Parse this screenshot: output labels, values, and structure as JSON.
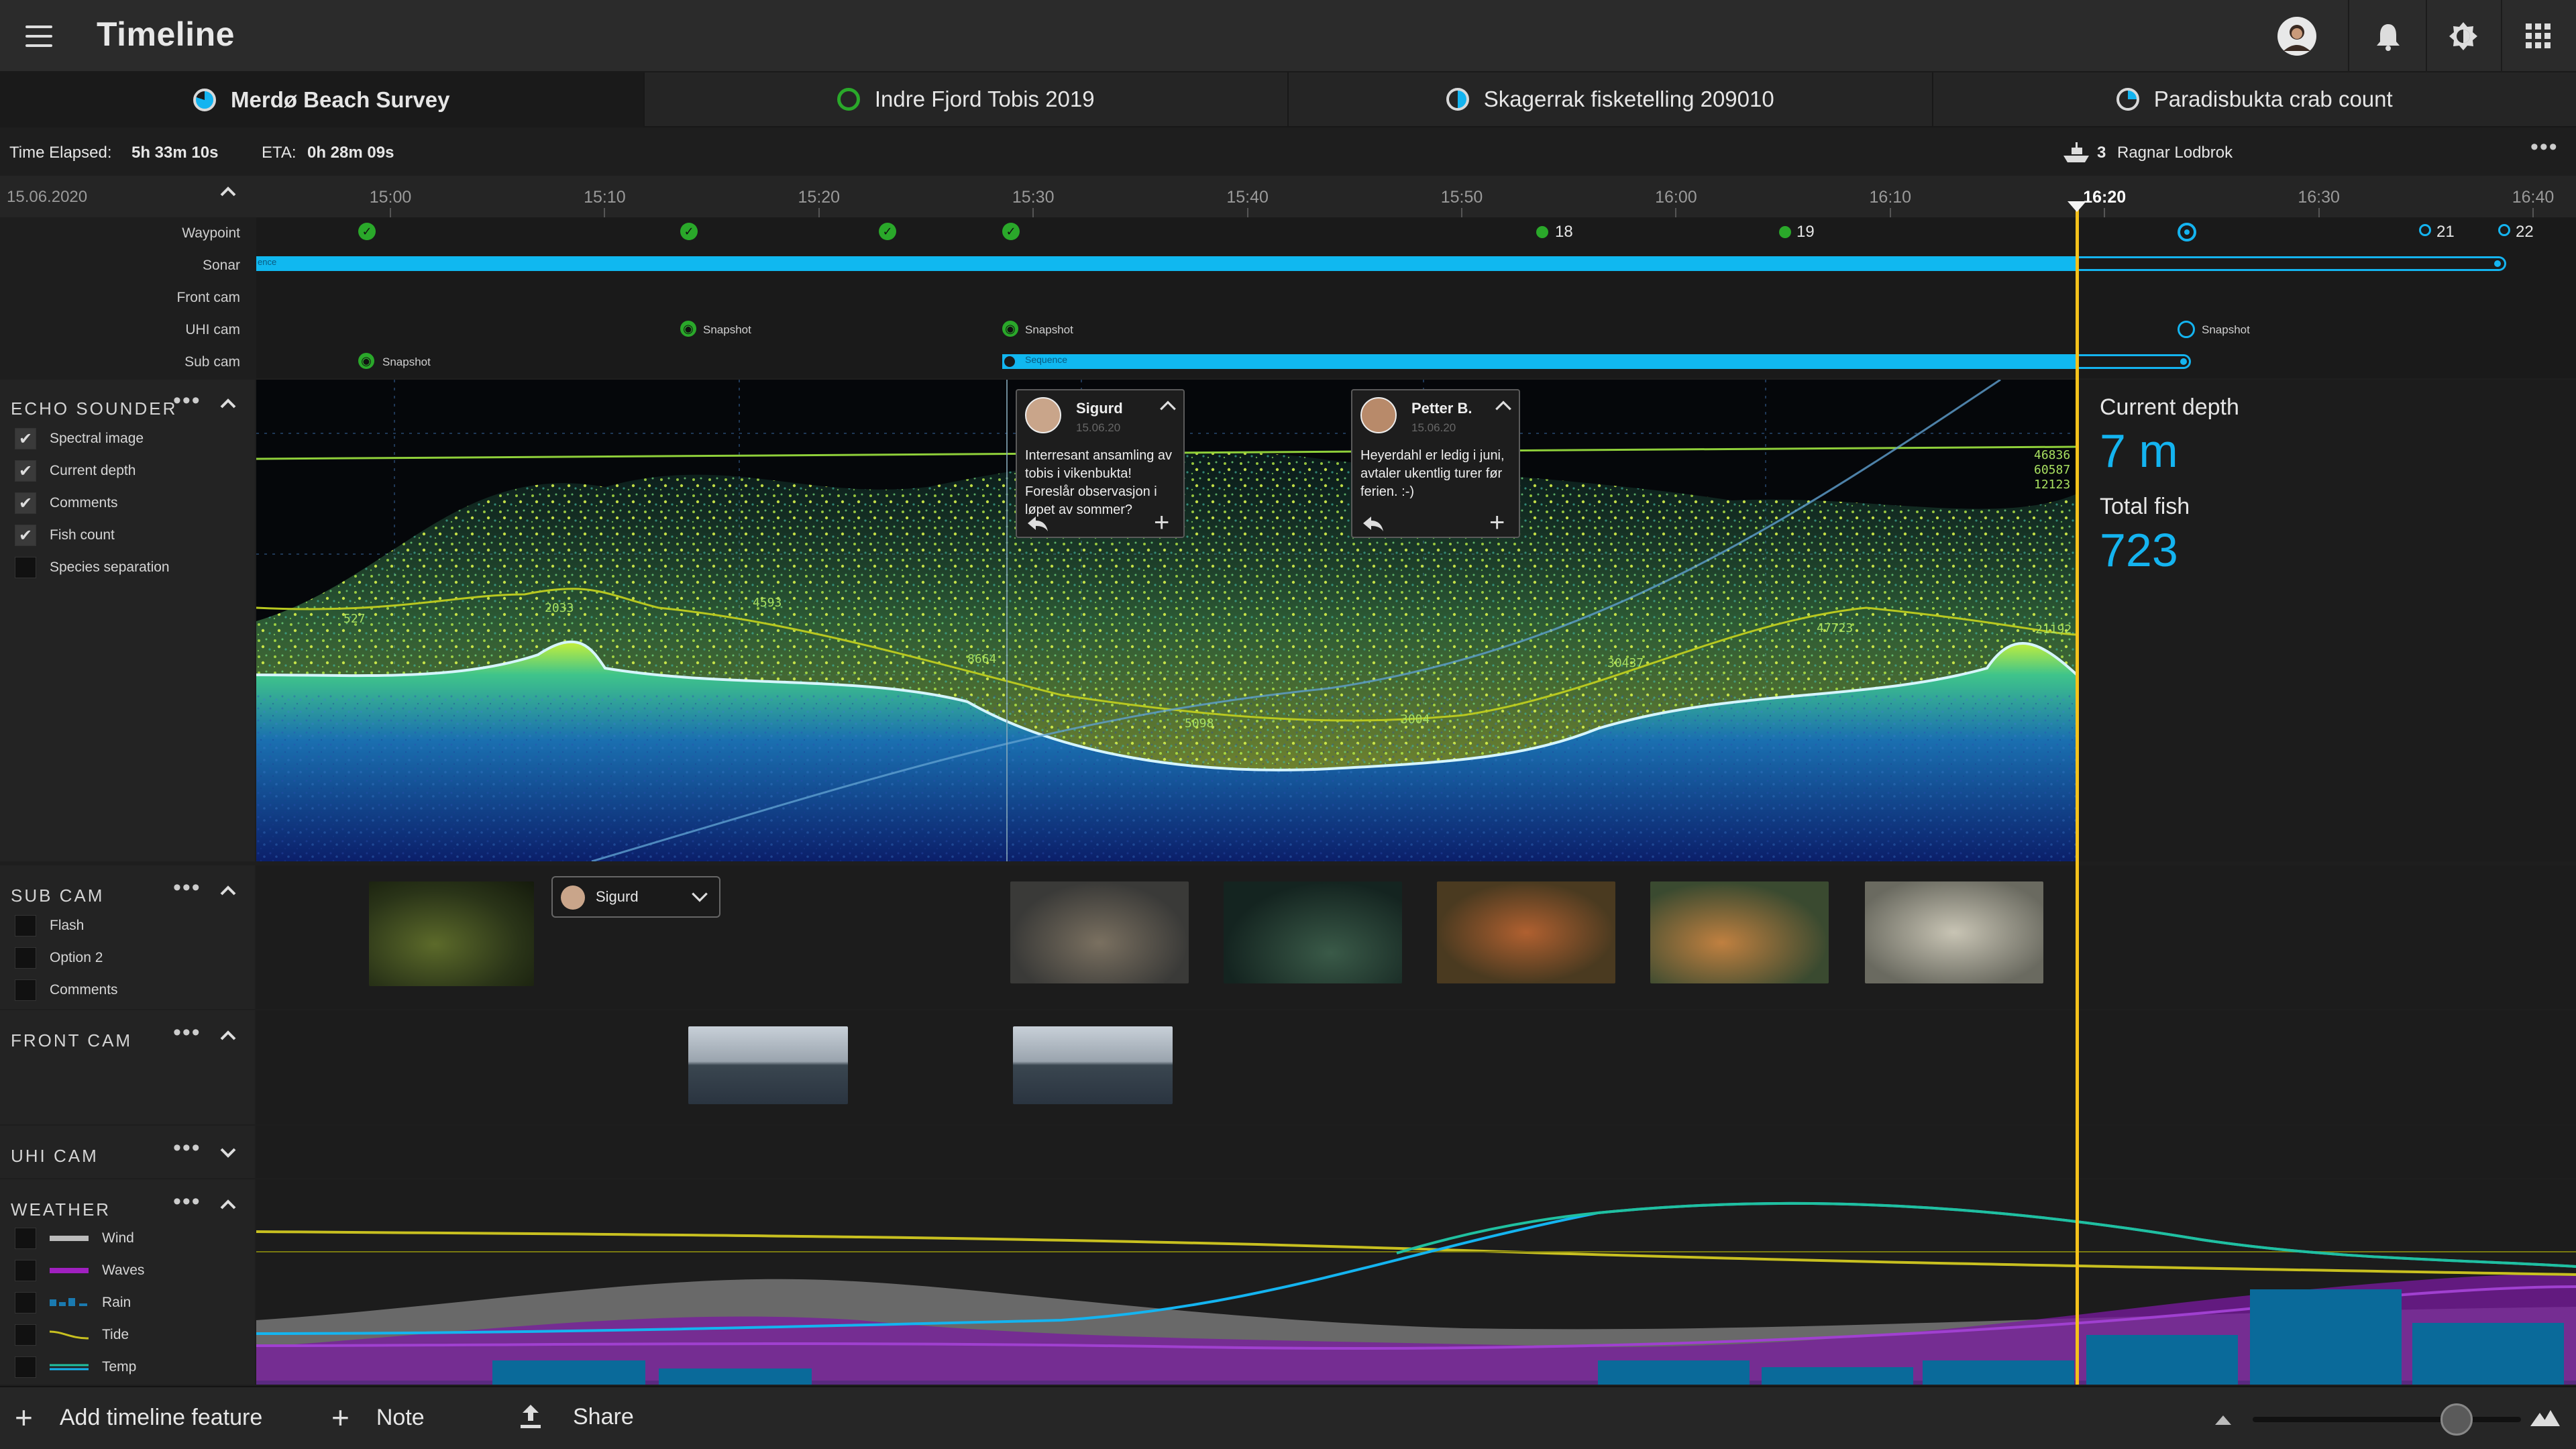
{
  "app": {
    "title": "Timeline"
  },
  "tabs": [
    {
      "label": "Merdø Beach Survey",
      "active": true,
      "ring": "#14b4f0"
    },
    {
      "label": "Indre Fjord Tobis 2019",
      "active": false,
      "ring": "#2aa82a"
    },
    {
      "label": "Skagerrak fisketelling 209010",
      "active": false,
      "ring": "#14b4f0"
    },
    {
      "label": "Paradisbukta crab count",
      "active": false,
      "ring": "#14b4f0"
    }
  ],
  "info": {
    "elapsed_label": "Time Elapsed:",
    "elapsed_value": "5h 33m 10s",
    "eta_label": "ETA:",
    "eta_value": "0h 28m 09s",
    "vessel_count": "3",
    "vessel_name": "Ragnar Lodbrok",
    "more": "•••"
  },
  "timeline": {
    "date": "15.06.2020",
    "ticks": [
      "15:00",
      "15:10",
      "15:20",
      "15:30",
      "15:40",
      "15:50",
      "16:00",
      "16:10",
      "16:20",
      "16:30",
      "16:40"
    ],
    "current_tick": "16:20",
    "tracks": [
      "Waypoint",
      "Sonar",
      "Front cam",
      "UHI cam",
      "Sub cam"
    ],
    "waypoint_labels": [
      "18",
      "19",
      "21",
      "22"
    ],
    "snapshot_label": "Snapshot",
    "sequence_label": "Sequence",
    "sonar_label": "ence"
  },
  "echo_sounder": {
    "title": "ECHO SOUNDER",
    "options": [
      {
        "label": "Spectral image",
        "checked": true
      },
      {
        "label": "Current depth",
        "checked": true
      },
      {
        "label": "Comments",
        "checked": true
      },
      {
        "label": "Fish count",
        "checked": true
      },
      {
        "label": "Species separation",
        "checked": false
      }
    ],
    "current_depth_label": "Current depth",
    "current_depth_value": "7 m",
    "total_fish_label": "Total fish",
    "total_fish_value": "723",
    "overlay_numbers": [
      "527",
      "2033",
      "4593",
      "8664",
      "5098",
      "3004",
      "30437",
      "47723",
      "21192",
      "46836",
      "60587",
      "12123"
    ],
    "comments": [
      {
        "author": "Sigurd",
        "date": "15.06.20",
        "text": "Interresant ansamling av tobis i vikenbukta! Foreslår observasjon i løpet av sommer?"
      },
      {
        "author": "Petter B.",
        "date": "15.06.20",
        "text": "Heyerdahl er ledig i juni, avtaler ukentlig turer før ferien. :-)"
      }
    ]
  },
  "sub_cam": {
    "title": "SUB CAM",
    "options": [
      {
        "label": "Flash",
        "checked": false
      },
      {
        "label": "Option 2",
        "checked": false
      },
      {
        "label": "Comments",
        "checked": false
      }
    ],
    "user_chip": "Sigurd"
  },
  "front_cam": {
    "title": "FRONT CAM"
  },
  "uhi_cam": {
    "title": "UHI CAM"
  },
  "weather": {
    "title": "WEATHER",
    "options": [
      {
        "label": "Wind",
        "checked": false
      },
      {
        "label": "Waves",
        "checked": false
      },
      {
        "label": "Rain",
        "checked": false
      },
      {
        "label": "Tide",
        "checked": false
      },
      {
        "label": "Temp",
        "checked": false
      }
    ]
  },
  "footer": {
    "add_feature": "Add timeline feature",
    "note": "Note",
    "share": "Share",
    "zoom_level": 0.76
  },
  "colors": {
    "accent": "#14b4f0",
    "playhead": "#f5c21b",
    "waypoint_done": "#2aa82a",
    "waves": "#a020c0",
    "tide": "#c8c020",
    "temp": "#20c0a0"
  }
}
